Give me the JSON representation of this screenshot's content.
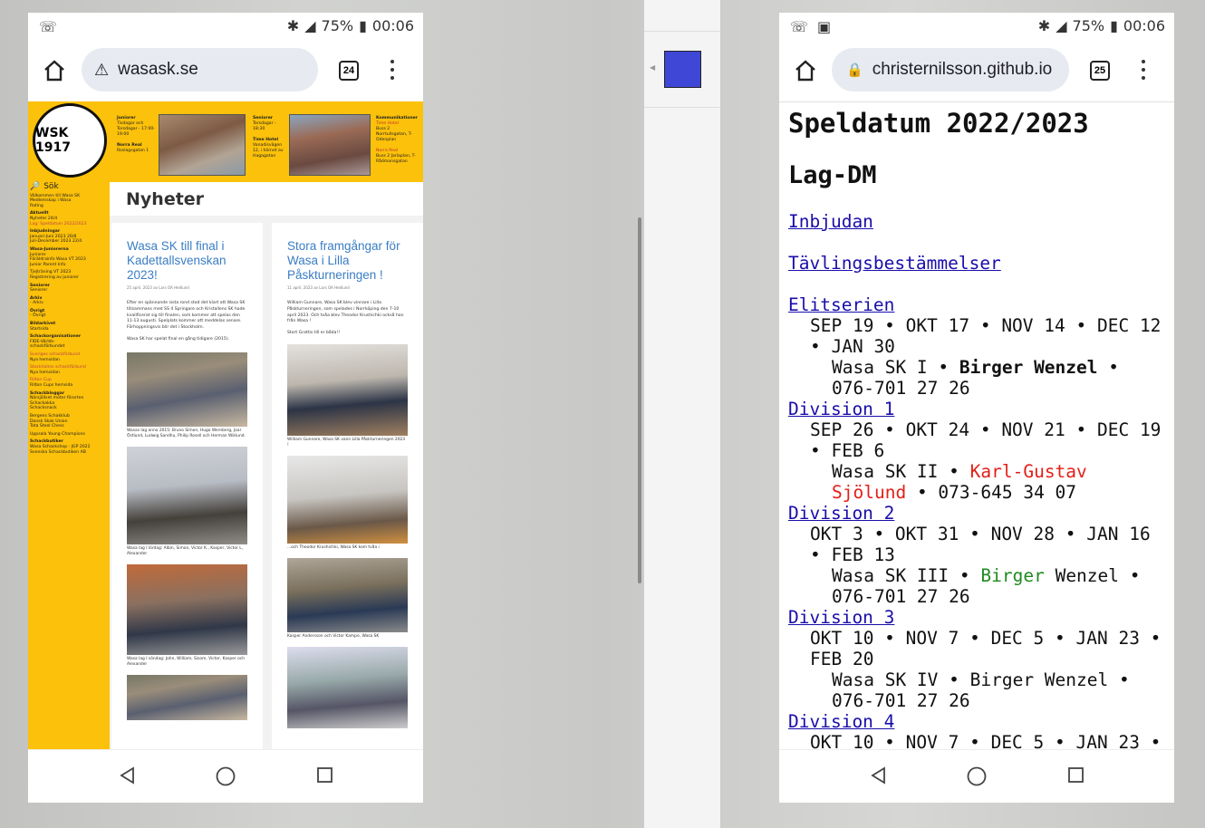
{
  "left_phone": {
    "status": {
      "battery": "75%",
      "time": "00:06"
    },
    "url": "wasask.se",
    "tab_count": "24",
    "banner": {
      "logo_text": "WSK 1917",
      "juniorer_title": "Juniorer",
      "juniorer_text": "Tisdagar och Torsdagar - 17:00-19:00",
      "norra_real_title": "Norra Real",
      "norra_real_text": "Roslagsgatan 1",
      "seniorer_title": "Seniorer",
      "seniorer_text": "Torsdagar - 18:30",
      "time_hotel_title": "Time Hotel",
      "time_hotel_text": "Vanadisvägen 12, i hörnet av Hagagatan",
      "kommunikationer_title": "Kommunikationer",
      "komm_time_hotel": "Time Hotel",
      "komm_time_hotel_text": "Buss 2 Norrtullsgatan, T-Odenplan",
      "komm_norra_real": "Norra Real",
      "komm_norra_real_text": "Buss 2 Jarlaplan, T-Rådmansgatan"
    },
    "sidebar": {
      "search": "Sök",
      "items": [
        "Välkommen till Wasa SK",
        "Medlemskap i Wasa",
        "Rating"
      ],
      "sections": [
        {
          "head": "Aktuellt",
          "lines": [
            "Nyheter 24/4",
            "Lag: Speldatum 2022/2023"
          ]
        },
        {
          "head": "Inbjudningar",
          "lines": [
            "Januari-Juni 2023   26/8",
            "Juli-December 2023   22/4"
          ]
        },
        {
          "head": "Wasa-Juniorerna",
          "lines": [
            "Juniorer",
            "Föräldrainfo Wasa VT 2023",
            "Junior Parent Info"
          ]
        },
        {
          "head": "",
          "lines": [
            "Tjejträning VT 2023",
            "Registrering av juniorer"
          ]
        },
        {
          "head": "Seniorer",
          "lines": [
            "Seniorer"
          ]
        },
        {
          "head": "Arkiv",
          "lines": [
            "- Arkiv"
          ]
        },
        {
          "head": "Övrigt",
          "lines": [
            "- Övrigt"
          ]
        },
        {
          "head": "Bildarkivet",
          "lines": [
            "Startsida"
          ]
        },
        {
          "head": "Schackorganisationer",
          "lines": [
            "FIDE-Världs-",
            "schackförbundet"
          ]
        },
        {
          "head": "",
          "lines": [
            "Sveriges schackförbund",
            "Nya hemsidan"
          ]
        },
        {
          "head": "",
          "lines": [
            "Stockholms schackförbund",
            "Nya hemsidan"
          ]
        },
        {
          "head": "",
          "lines": [
            "Rilton Cup",
            "Rilton Cups hemsida"
          ]
        },
        {
          "head": "Schackbloggar",
          "lines": [
            "Närsjällset möter förorten",
            "Schackakka",
            "Schacksnack"
          ]
        },
        {
          "head": "",
          "lines": [
            "Bergens Schakklub",
            "Dansk Skak Union",
            "Tata Steel Chess"
          ]
        },
        {
          "head": "",
          "lines": [
            "Uppsala Young Champions"
          ]
        },
        {
          "head": "Schackbutiker",
          "lines": [
            "Wasa Schackshop - JGP 2022",
            "Svenska Schackbutiken AB"
          ]
        }
      ]
    },
    "section_title": "Nyheter",
    "post1": {
      "title": "Wasa SK till final i Kadettallsvenskan 2023!",
      "meta": "25 april, 2023 av Lars OA Hedlund",
      "p1": "Efter en spännande sista rond stod det klart att Wasa SK tillsammans med SS 4 Springare och Kristallens SK hade kvalificerat sig till finalen, som kommer att spelas den 11-13 augusti. Spelplats kommer att meddelas senare. Förhoppningsvis blir det i Stockholm.",
      "p2": "Wasa SK har spelat final en gång tidigare (2015).",
      "cap1": "Wasas lag anno 2015: Bruno Simon, Hugo Wernberg, Joar Östlund, Ludwig Sandhu, Philip Rosell och Herman Wiklund.",
      "cap2": "Wasa lag I lördag: Albin, Simon, Victor K., Kasper, Victor L, Alexander",
      "cap3": "Wasa lag I söndag: John, William, Sisom, Victor, Kasper och Alexander"
    },
    "post2": {
      "title": "Stora framgångar för Wasa i Lilla Påskturneringen !",
      "meta": "11 april, 2023 av Lars OA Hedlund",
      "p1": "William Gunnare, Wasa SK blev vinnare i Lilla Påskturneringen, som spelades i Norrköping den 7-10 april 2023. Och tvåa blev Theodor Krushichki också han från Wasa !",
      "p2": "Stort Grattis till er båda!!",
      "cap1": "William Gunnare, Wasa SK vann Lilla Påskturneringen 2023 !",
      "cap2": "...och Theodor Krushichki, Wasa SK kom tvåa i",
      "cap3": "Kasper Andersson och Victor Kampe, Wasa SK"
    }
  },
  "right_phone": {
    "status": {
      "battery": "75%",
      "time": "00:06"
    },
    "url": "christernilsson.github.io",
    "tab_count": "25",
    "h1": "Speldatum 2022/2023",
    "h2": "Lag-DM",
    "link_inbjudan": "Inbjudan",
    "link_tavling": "Tävlingsbestämmelser",
    "divisions": [
      {
        "name": "Elitserien",
        "dates": "SEP 19 • OKT 17 • NOV 14 • DEC 12 • JAN 30",
        "team": "Wasa SK I •",
        "leader": "Birger Wenzel",
        "phone": "• 076-701 27 26"
      },
      {
        "name": "Division 1",
        "dates": "SEP 26 • OKT 24 • NOV 21 • DEC 19 • FEB 6",
        "team": "Wasa SK II •",
        "leader": "Karl-Gustav Sjölund",
        "phone": "• 073-645 34 07"
      },
      {
        "name": "Division 2",
        "dates": "OKT 3 • OKT 31 • NOV 28 • JAN 16 • FEB 13",
        "team": "Wasa SK III •",
        "leader_first": "Birger",
        "leader_last": "Wenzel",
        "phone": "• 076-701 27 26"
      },
      {
        "name": "Division 3",
        "dates": "OKT 10 • NOV 7 • DEC 5 • JAN 23 • FEB 20",
        "team": "Wasa SK IV • Birger Wenzel •",
        "phone": "076-701 27 26"
      },
      {
        "name": "Division 4",
        "dates": "OKT 10 • NOV 7 • DEC 5 • JAN 23 •"
      }
    ]
  },
  "colors": {
    "site_yellow": "#fcc10a",
    "link_blue": "#1a0dab",
    "leader_red": "#e32018",
    "leader_green": "#1f8a1f",
    "panel_square": "#3f47d6"
  }
}
